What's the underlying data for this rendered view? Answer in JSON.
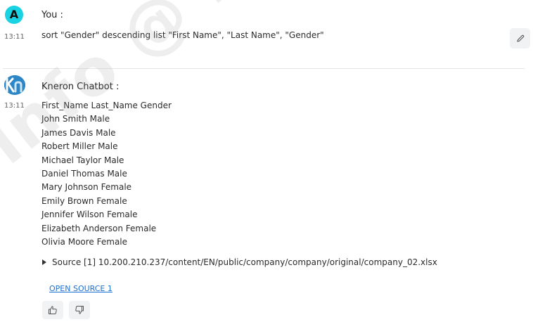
{
  "user_message": {
    "avatar_letter": "A",
    "sender": "You :",
    "time": "13:11",
    "text": "sort \"Gender\" descending list \"First Name\", \"Last Name\", \"Gender\""
  },
  "bot_message": {
    "avatar_text": "Kn",
    "sender": "Kneron Chatbot :",
    "time": "13:11",
    "lines": [
      "First_Name Last_Name Gender",
      "John Smith Male",
      "James Davis Male",
      "Robert Miller Male",
      "Michael Taylor Male",
      "Daniel Thomas Male",
      "Mary Johnson Female",
      "Emily Brown Female",
      "Jennifer Wilson Female",
      "Elizabeth Anderson Female",
      "Olivia Moore Female"
    ],
    "source": "Source [1] 10.200.210.237/content/EN/public/company/company/original/company_02.xlsx",
    "open_source_label": "OPEN SOURCE 1"
  },
  "watermark": "info @ kneron",
  "icons": {
    "edit": "pencil-icon",
    "like": "thumbs-up-icon",
    "dislike": "thumbs-down-icon",
    "expand": "caret-right-icon"
  },
  "colors": {
    "user_avatar": "#19d3e3",
    "bot_avatar": "#2d86c6",
    "link": "#1a6fd0",
    "button_bg": "#f1f2f4"
  }
}
